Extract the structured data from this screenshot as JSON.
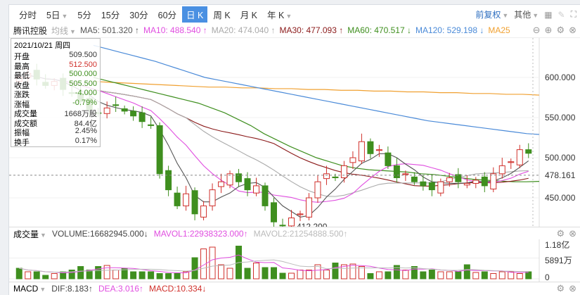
{
  "toolbar": {
    "periods": [
      "分时",
      "5日",
      "5分",
      "15分",
      "30分",
      "60分",
      "日 K",
      "周 K",
      "月 K",
      "年 K"
    ],
    "active": "日 K",
    "fuquan": "前复权",
    "other": "其他"
  },
  "legend": {
    "stock": "腾讯控股",
    "ma_label": "均线",
    "ma5": "MA5: 501.320 ↑",
    "ma10": "MA10: 488.540 ↑",
    "ma20": "MA20: 474.040 ↑",
    "ma30": "MA30: 477.093 ↑",
    "ma60": "MA60: 470.517 ↓",
    "ma120": "MA120: 529.198 ↓",
    "ma250": "MA25"
  },
  "colors": {
    "up": "#d0302b",
    "down": "#3f8f1f",
    "ma5": "#555",
    "ma10": "#e04ee0",
    "ma20": "#aaa",
    "ma30": "#8b1a1a",
    "ma60": "#3f8f1f",
    "ma120": "#4a8ad8",
    "ma250": "#f0a030"
  },
  "tooltip": {
    "date": "2021/10/21 周四",
    "rows": [
      [
        "开盘",
        "509.500"
      ],
      [
        "最高",
        "512.500"
      ],
      [
        "最低",
        "500.000"
      ],
      [
        "收盘",
        "505.500"
      ],
      [
        "涨跌",
        "-4.000"
      ],
      [
        "涨幅",
        "-0.79%"
      ],
      [
        "成交量",
        "1668万股"
      ],
      [
        "成交额",
        "84.4亿"
      ],
      [
        "振幅",
        "2.45%"
      ],
      [
        "换手",
        "0.17%"
      ]
    ]
  },
  "price_axis": {
    "ticks": [
      "600.000",
      "550.000",
      "500.000",
      "450.000"
    ],
    "current": "478.161",
    "low_label": "412.200"
  },
  "chart_data": {
    "type": "candlestick",
    "ylim": [
      400,
      660
    ],
    "close": [
      600,
      605,
      598,
      590,
      595,
      585,
      580,
      570,
      560,
      555,
      562,
      565,
      558,
      552,
      545,
      540,
      480,
      460,
      440,
      455,
      430,
      440,
      460,
      470,
      480,
      470,
      460,
      465,
      440,
      420,
      415,
      425,
      430,
      450,
      470,
      480,
      475,
      490,
      500,
      520,
      505,
      510,
      490,
      475,
      480,
      470,
      465,
      460,
      470,
      475,
      470,
      468,
      472,
      465,
      480,
      490,
      495,
      510,
      505.5
    ],
    "volume": [
      3,
      2,
      2,
      1,
      1.5,
      2,
      2.5,
      3.5,
      2.5,
      3.5,
      3.8,
      2.5,
      3,
      2,
      2,
      2,
      1.5,
      1.5,
      1.5,
      2,
      6,
      8.5,
      9,
      4,
      3,
      9.3,
      3,
      4.5,
      3.2,
      3.2,
      1.6,
      1.6,
      2.5,
      2.5,
      4,
      2.5,
      4.5,
      4,
      4.2,
      3.5,
      1.5,
      2,
      2,
      3.8,
      2.5,
      3.5,
      2,
      2.5,
      2,
      2,
      2,
      4,
      1.8,
      2,
      1.5,
      2,
      2,
      1.5,
      2,
      1.5,
      1.5,
      1.5,
      2,
      2,
      2.5,
      2,
      2.5,
      2,
      2.5,
      2,
      1.8,
      2.5,
      2
    ],
    "ma120": [
      640,
      636,
      632,
      628,
      624,
      620,
      615,
      610,
      605,
      600,
      597,
      594,
      591,
      588,
      585,
      582,
      579,
      576,
      573,
      570,
      567,
      564,
      561,
      558,
      555,
      552,
      549,
      546,
      544,
      542,
      540,
      538,
      536,
      534,
      532,
      530,
      529
    ],
    "ma250": [
      595,
      594,
      593,
      592,
      591,
      590,
      589,
      588,
      588,
      587,
      587,
      586,
      586,
      585,
      585,
      584,
      584,
      583,
      583,
      582,
      582,
      581,
      581,
      580,
      580,
      579,
      579,
      578
    ],
    "ma60": [
      600,
      596,
      592,
      588,
      584,
      580,
      576,
      572,
      568,
      562,
      556,
      548,
      540,
      530,
      522,
      514,
      507,
      500,
      495,
      490,
      487,
      485,
      484,
      483,
      482,
      480,
      479,
      477,
      475,
      473,
      472,
      471,
      470,
      470,
      470.5
    ]
  },
  "volume_panel": {
    "label": "成交量",
    "volume": "VOLUME:16682945.000↓",
    "mavol1": "MAVOL1:22938323.000↑",
    "mavol2": "MAVOL2:21254888.500↑",
    "ticks": [
      "1.18亿",
      "5891万",
      "0"
    ]
  },
  "macd_panel": {
    "label": "MACD",
    "dif": "DIF:8.183↑",
    "dea": "DEA:3.016↑",
    "macd": "MACD:10.334↓"
  }
}
